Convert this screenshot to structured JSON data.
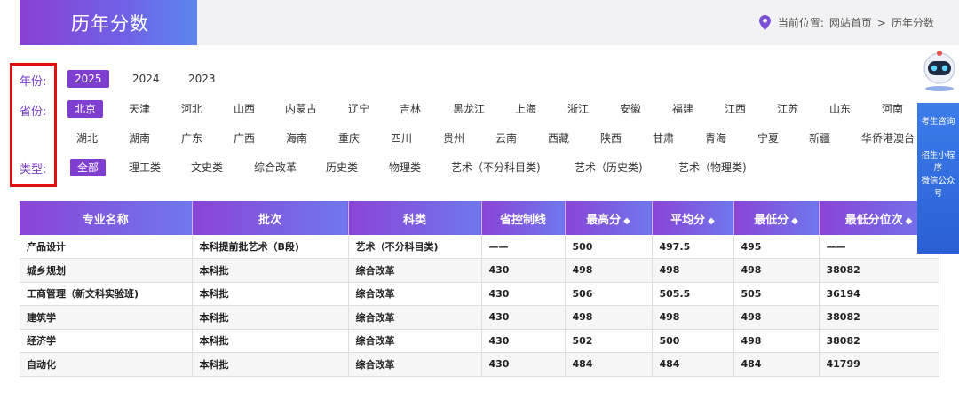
{
  "header": {
    "title": "历年分数",
    "breadcrumb_label": "当前位置:",
    "breadcrumb_home": "网站首页",
    "breadcrumb_sep": ">",
    "breadcrumb_current": "历年分数"
  },
  "filters": {
    "year_label": "年份:",
    "years": [
      "2025",
      "2024",
      "2023"
    ],
    "province_label": "省份:",
    "provinces_row1": [
      "北京",
      "天津",
      "河北",
      "山西",
      "内蒙古",
      "辽宁",
      "吉林",
      "黑龙江",
      "上海",
      "浙江",
      "安徽",
      "福建",
      "江西",
      "江苏",
      "山东",
      "河南"
    ],
    "provinces_row2": [
      "湖北",
      "湖南",
      "广东",
      "广西",
      "海南",
      "重庆",
      "四川",
      "贵州",
      "云南",
      "西藏",
      "陕西",
      "甘肃",
      "青海",
      "宁夏",
      "新疆",
      "华侨港澳台"
    ],
    "type_label": "类型:",
    "types": [
      "全部",
      "理工类",
      "文史类",
      "综合改革",
      "历史类",
      "物理类",
      "艺术（不分科目类)",
      "艺术（历史类)",
      "艺术（物理类)"
    ]
  },
  "table": {
    "headers": [
      "专业名称",
      "批次",
      "科类",
      "省控制线",
      "最高分",
      "平均分",
      "最低分",
      "最低分位次"
    ],
    "sort_icon": "◆",
    "rows": [
      [
        "产品设计",
        "本科提前批艺术（B段)",
        "艺术（不分科目类)",
        "——",
        "500",
        "497.5",
        "495",
        "——"
      ],
      [
        "城乡规划",
        "本科批",
        "综合改革",
        "430",
        "498",
        "498",
        "498",
        "38082"
      ],
      [
        "工商管理（新文科实验班)",
        "本科批",
        "综合改革",
        "430",
        "506",
        "505.5",
        "505",
        "36194"
      ],
      [
        "建筑学",
        "本科批",
        "综合改革",
        "430",
        "498",
        "498",
        "498",
        "38082"
      ],
      [
        "经济学",
        "本科批",
        "综合改革",
        "430",
        "502",
        "500",
        "498",
        "38082"
      ],
      [
        "自动化",
        "本科批",
        "综合改革",
        "430",
        "484",
        "484",
        "484",
        "41799"
      ]
    ]
  },
  "side": {
    "consult": "考生咨询",
    "mini_program": "招生小程序",
    "wechat": "微信公众号"
  },
  "colors": {
    "accent": "#7e3fd0",
    "highlight_box": "#e20f0f",
    "side_panel": "#2f6ddc"
  }
}
